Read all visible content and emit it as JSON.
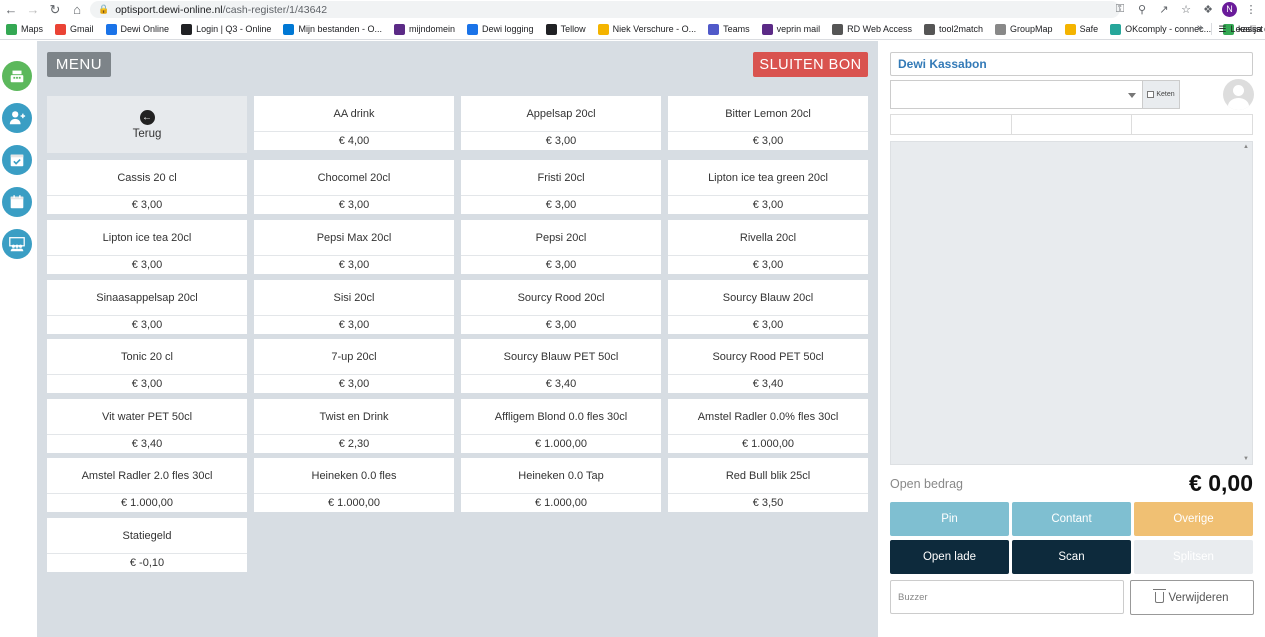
{
  "browser": {
    "url_host": "optisport.dewi-online.nl",
    "url_path": "/cash-register/1/43642",
    "profile_initial": "N",
    "bookmarks": [
      {
        "label": "Maps",
        "color": "#34a853"
      },
      {
        "label": "Gmail",
        "color": "#ea4335"
      },
      {
        "label": "Dewi Online",
        "color": "#1a73e8"
      },
      {
        "label": "Login | Q3 - Online",
        "color": "#202124"
      },
      {
        "label": "Mijn bestanden - O...",
        "color": "#0078d4"
      },
      {
        "label": "mijndomein",
        "color": "#5b2a86"
      },
      {
        "label": "Dewi logging",
        "color": "#1a73e8"
      },
      {
        "label": "Tellow",
        "color": "#202124"
      },
      {
        "label": "Niek Verschure - O...",
        "color": "#f4b400"
      },
      {
        "label": "Teams",
        "color": "#5059c9"
      },
      {
        "label": "veprin mail",
        "color": "#5b2a86"
      },
      {
        "label": "RD Web Access",
        "color": "#555555"
      },
      {
        "label": "tool2match",
        "color": "#555555"
      },
      {
        "label": "GroupMap",
        "color": "#888888"
      },
      {
        "label": "Safe",
        "color": "#f4b400"
      },
      {
        "label": "OKcomply - connec...",
        "color": "#26a69a"
      },
      {
        "label": "kassa drive",
        "color": "#34a853"
      }
    ],
    "more_label": "»",
    "reading_list": "Leeslijst"
  },
  "header": {
    "menu_label": "MENU",
    "close_label": "SLUITEN BON"
  },
  "back_tile": {
    "label": "Terug"
  },
  "products": [
    {
      "name": "AA drink",
      "price": "€ 4,00"
    },
    {
      "name": "Appelsap 20cl",
      "price": "€ 3,00"
    },
    {
      "name": "Bitter Lemon 20cl",
      "price": "€ 3,00"
    },
    {
      "name": "Cassis 20 cl",
      "price": "€ 3,00"
    },
    {
      "name": "Chocomel 20cl",
      "price": "€ 3,00"
    },
    {
      "name": "Fristi 20cl",
      "price": "€ 3,00"
    },
    {
      "name": "Lipton ice tea green 20cl",
      "price": "€ 3,00"
    },
    {
      "name": "Lipton ice tea 20cl",
      "price": "€ 3,00"
    },
    {
      "name": "Pepsi Max 20cl",
      "price": "€ 3,00"
    },
    {
      "name": "Pepsi 20cl",
      "price": "€ 3,00"
    },
    {
      "name": "Rivella 20cl",
      "price": "€ 3,00"
    },
    {
      "name": "Sinaasappelsap 20cl",
      "price": "€ 3,00"
    },
    {
      "name": "Sisi 20cl",
      "price": "€ 3,00"
    },
    {
      "name": "Sourcy Rood 20cl",
      "price": "€ 3,00"
    },
    {
      "name": "Sourcy Blauw 20cl",
      "price": "€ 3,00"
    },
    {
      "name": "Tonic 20 cl",
      "price": "€ 3,00"
    },
    {
      "name": "7-up 20cl",
      "price": "€ 3,00"
    },
    {
      "name": "Sourcy Blauw PET 50cl",
      "price": "€ 3,40"
    },
    {
      "name": "Sourcy Rood PET 50cl",
      "price": "€ 3,40"
    },
    {
      "name": "Vit water PET 50cl",
      "price": "€ 3,40"
    },
    {
      "name": "Twist en Drink",
      "price": "€ 2,30"
    },
    {
      "name": "Affligem Blond 0.0 fles 30cl",
      "price": "€ 1.000,00"
    },
    {
      "name": "Amstel Radler 0.0% fles 30cl",
      "price": "€ 1.000,00"
    },
    {
      "name": "Amstel Radler 2.0 fles 30cl",
      "price": "€ 1.000,00"
    },
    {
      "name": "Heineken 0.0 fles",
      "price": "€ 1.000,00"
    },
    {
      "name": "Heineken 0.0 Tap",
      "price": "€ 1.000,00"
    },
    {
      "name": "Red Bull blik 25cl",
      "price": "€ 3,50"
    },
    {
      "name": "Statiegeld",
      "price": "€ -0,10"
    }
  ],
  "receipt": {
    "title": "Dewi Kassabon",
    "keten_label": "Keten",
    "open_label": "Open bedrag",
    "open_amount": "€ 0,00",
    "buttons": {
      "pin": "Pin",
      "contant": "Contant",
      "overige": "Overige",
      "open_lade": "Open lade",
      "scan": "Scan",
      "splitsen": "Splitsen",
      "delete": "Verwijderen"
    },
    "buzzer_placeholder": "Buzzer"
  },
  "nav_icons": [
    {
      "name": "cash-register-icon",
      "color": "#5cb85c"
    },
    {
      "name": "add-user-icon",
      "color": "#3a9ec4"
    },
    {
      "name": "calendar-check-icon",
      "color": "#3a9ec4"
    },
    {
      "name": "calendar-icon",
      "color": "#3a9ec4"
    },
    {
      "name": "group-icon",
      "color": "#3a9ec4"
    }
  ]
}
